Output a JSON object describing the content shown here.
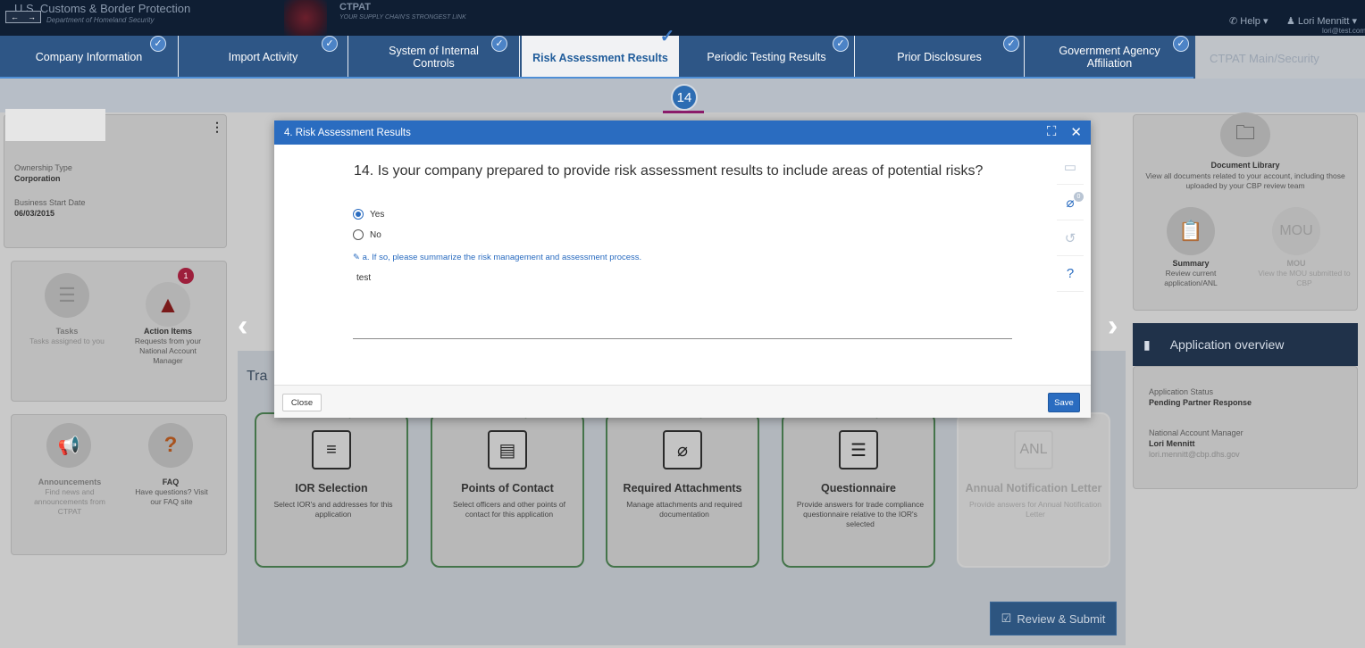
{
  "header": {
    "agency": "U.S. Customs & Border Protection",
    "agency_sub": "Department of Homeland Security",
    "nav_back": "←",
    "nav_forward": "→",
    "program": "CTPAT",
    "program_sub": "YOUR SUPPLY CHAIN'S STRONGEST LINK",
    "help": "Help ▾",
    "user": "Lori Mennitt ▾",
    "email": "lori@test.com"
  },
  "tabs": [
    {
      "label": "Company Information",
      "checked": true
    },
    {
      "label": "Import Activity",
      "checked": true
    },
    {
      "label": "System of Internal Controls",
      "checked": true
    },
    {
      "label": "Risk Assessment Results",
      "checked": true,
      "active": true
    },
    {
      "label": "Periodic Testing Results",
      "checked": true
    },
    {
      "label": "Prior Disclosures",
      "checked": true
    },
    {
      "label": "Government Agency Affiliation",
      "checked": true
    }
  ],
  "tabs_right": "CTPAT Main/Security",
  "step_number": "14",
  "left_panel": {
    "ownership_label": "Ownership Type",
    "ownership_value": "Corporation",
    "start_label": "Business Start Date",
    "start_value": "06/03/2015",
    "tasks_title": "Tasks",
    "tasks_desc": "Tasks assigned to you",
    "action_title": "Action Items",
    "action_desc": "Requests from your National Account Manager",
    "action_badge": "1",
    "ann_title": "Announcements",
    "ann_desc": "Find news and announcements from CTPAT",
    "faq_title": "FAQ",
    "faq_desc": "Have questions? Visit our FAQ site"
  },
  "workflow": {
    "title": "Tra",
    "cards": [
      {
        "title": "IOR Selection",
        "desc": "Select IOR's and addresses for this application"
      },
      {
        "title": "Points of Contact",
        "desc": "Select officers and other points of contact for this application"
      },
      {
        "title": "Required Attachments",
        "desc": "Manage attachments and required documentation"
      },
      {
        "title": "Questionnaire",
        "desc": "Provide answers for trade compliance questionnaire relative to the IOR's selected"
      },
      {
        "title": "Annual Notification Letter",
        "desc": "Provide answers for Annual Notification Letter",
        "icon_text": "ANL"
      }
    ],
    "review_label": "Review & Submit"
  },
  "right_panel": {
    "doclib_title": "Document Library",
    "doclib_desc": "View all documents related to your account, including those uploaded by your CBP review team",
    "summary_title": "Summary",
    "summary_desc": "Review current application/ANL",
    "mou_icon": "MOU",
    "mou_title": "MOU",
    "mou_desc": "View the MOU submitted to CBP",
    "overview_title": "Application overview",
    "status_label": "Application Status",
    "status_value": "Pending Partner Response",
    "nam_label": "National Account Manager",
    "nam_value": "Lori Mennitt",
    "nam_email": "lori.mennitt@cbp.dhs.gov"
  },
  "modal": {
    "title": "4. Risk Assessment Results",
    "question": "14. Is your company prepared to provide risk assessment results to include areas of potential risks?",
    "option_yes": "Yes",
    "option_no": "No",
    "selected": "Yes",
    "sub_question": "a. If so, please summarize the risk management and assessment process.",
    "answer": "test",
    "attachment_count": "0",
    "close_label": "Close",
    "save_label": "Save"
  }
}
